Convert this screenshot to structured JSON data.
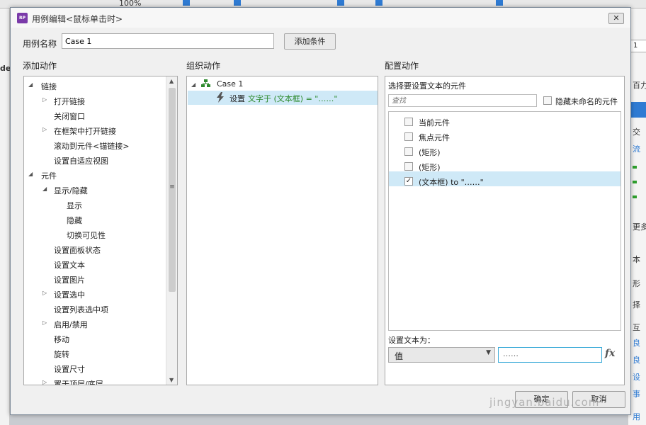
{
  "bg": {
    "zoom": "100%",
    "left_label": "dex",
    "right_texts": [
      "1",
      "百力",
      "交",
      "流",
      "更多",
      "本",
      "形",
      "择",
      "互",
      "良",
      "良",
      "设",
      "事",
      "用"
    ]
  },
  "dialog": {
    "title": "用例编辑<鼠标单击时>",
    "app_icon": "RP",
    "close_glyph": "✕",
    "case_name_label": "用例名称",
    "case_name_value": "Case 1",
    "add_condition_label": "添加条件"
  },
  "add_actions": {
    "header": "添加动作",
    "items": [
      {
        "label": "链接",
        "expand": "expanded"
      },
      {
        "label": "打开链接",
        "expand": "collapsed"
      },
      {
        "label": "关闭窗口",
        "expand": "none"
      },
      {
        "label": "在框架中打开链接",
        "expand": "collapsed"
      },
      {
        "label": "滚动到元件<锚链接>",
        "expand": "none"
      },
      {
        "label": "设置自适应视图",
        "expand": "none"
      },
      {
        "label": "元件",
        "expand": "expanded"
      },
      {
        "label": "显示/隐藏",
        "expand": "expanded"
      },
      {
        "label": "显示",
        "expand": "none"
      },
      {
        "label": "隐藏",
        "expand": "none"
      },
      {
        "label": "切换可见性",
        "expand": "none"
      },
      {
        "label": "设置面板状态",
        "expand": "none"
      },
      {
        "label": "设置文本",
        "expand": "none"
      },
      {
        "label": "设置图片",
        "expand": "none"
      },
      {
        "label": "设置选中",
        "expand": "collapsed"
      },
      {
        "label": "设置列表选中项",
        "expand": "none"
      },
      {
        "label": "启用/禁用",
        "expand": "collapsed"
      },
      {
        "label": "移动",
        "expand": "none"
      },
      {
        "label": "旋转",
        "expand": "none"
      },
      {
        "label": "设置尺寸",
        "expand": "none"
      },
      {
        "label": "置于顶层/底层",
        "expand": "collapsed"
      }
    ]
  },
  "organize": {
    "header": "组织动作",
    "case_label": "Case 1",
    "action_prefix": "设置",
    "action_detail": "文字于 (文本框) = \"……\""
  },
  "configure": {
    "header": "配置动作",
    "select_widget_label": "选择要设置文本的元件",
    "search_placeholder": "查找",
    "hide_unnamed_label": "隐藏未命名的元件",
    "widgets": [
      {
        "label": "当前元件",
        "checked": false
      },
      {
        "label": "焦点元件",
        "checked": false
      },
      {
        "label": "(矩形)",
        "checked": false
      },
      {
        "label": "(矩形)",
        "checked": false
      },
      {
        "label": "(文本框) to \"……\"",
        "checked": true
      }
    ],
    "set_text_label": "设置文本为：",
    "value_type": "值",
    "value_text": "……",
    "fx_label": "fx"
  },
  "footer": {
    "ok_label": "确定",
    "cancel_label": "取消",
    "watermark": "jingyan.baidu.com"
  },
  "colors": {
    "selection": "#cfe9f7",
    "accent": "#2f7bd3",
    "action_green": "#2d8a2d",
    "app_icon": "#7a3aa9"
  }
}
